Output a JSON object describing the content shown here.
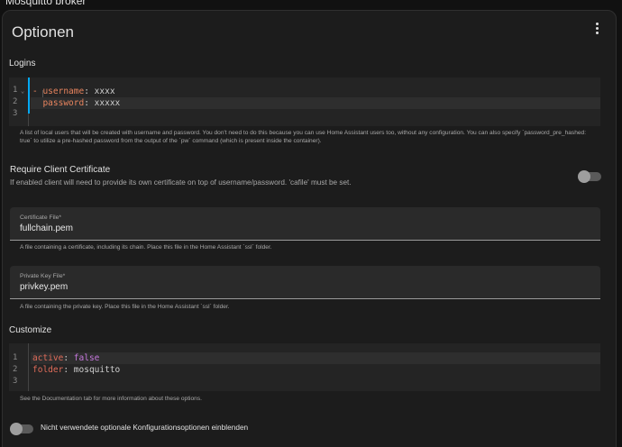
{
  "app": {
    "title": "Mosquitto broker"
  },
  "card": {
    "title": "Optionen",
    "menu_icon": "dots-vertical-icon"
  },
  "logins": {
    "label": "Logins",
    "lines": [
      {
        "num": "1",
        "key": "username",
        "value": "xxxx"
      },
      {
        "num": "2",
        "key": "password",
        "value": "xxxxx"
      },
      {
        "num": "3"
      }
    ],
    "fold_glyph": "⌄",
    "helper": "A list of local users that will be created with username and password. You don't need to do this because you can use Home Assistant users too, without any configuration. You can also specify `password_pre_hashed: true` to utilize a pre-hashed password from the output of the `pw` command (which is present inside the container)."
  },
  "client_cert": {
    "title": "Require Client Certificate",
    "description": "If enabled client will need to provide its own certificate on top of username/password. 'cafile' must be set.",
    "enabled": false
  },
  "certfile": {
    "label": "Certificate File*",
    "value": "fullchain.pem",
    "helper": "A file containing a certificate, including its chain. Place this file in the Home Assistant `ssl` folder."
  },
  "keyfile": {
    "label": "Private Key File*",
    "value": "privkey.pem",
    "helper": "A file containing the private key. Place this file in the Home Assistant `ssl` folder."
  },
  "customize": {
    "label": "Customize",
    "lines": [
      {
        "num": "1",
        "key": "active",
        "value": "false"
      },
      {
        "num": "2",
        "key": "folder",
        "value": "mosquitto"
      },
      {
        "num": "3"
      }
    ],
    "helper": "See the Documentation tab for more information about these options."
  },
  "optional_toggle": {
    "label": "Nicht verwendete optionale Konfigurationsoptionen einblenden",
    "enabled": false
  },
  "colors": {
    "accent": "#03a9f4",
    "key": "#e06c5a",
    "boolean": "#c678dd"
  }
}
